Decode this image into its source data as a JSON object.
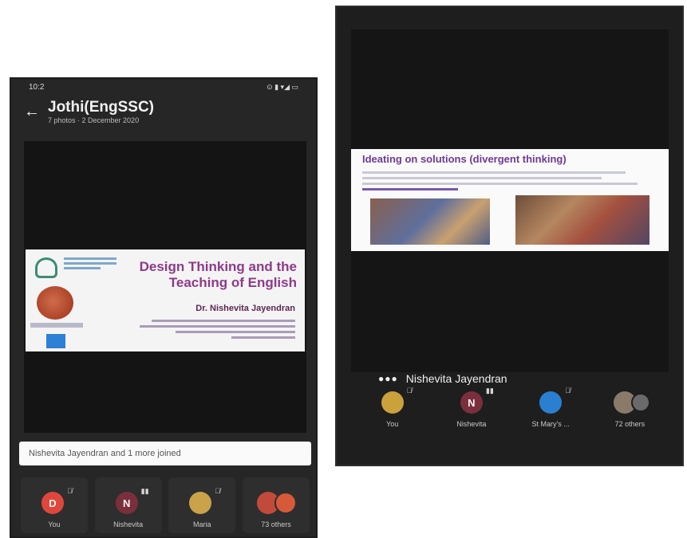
{
  "left_phone": {
    "status": {
      "time": "10:2",
      "icons": "⊙ ▮ ▾◢ ▭"
    },
    "header": {
      "title": "Jothi(EngSSC)",
      "subtitle": "7 photos · 2 December 2020"
    },
    "slide": {
      "title": "Design Thinking and the Teaching of English",
      "author": "Dr. Nishevita Jayendran"
    },
    "toast": "Nishevita Jayendran and 1 more joined",
    "participants": [
      {
        "initial": "D",
        "label": "You",
        "color": "#e0473c",
        "mic": "🎙̸"
      },
      {
        "initial": "N",
        "label": "Nishevita",
        "color": "#7b2f3d",
        "mic": "▮▮"
      },
      {
        "initial": "",
        "label": "Maria",
        "color": "#c9a24a",
        "mic": "🎙̸"
      },
      {
        "initial": "",
        "label": "73 others",
        "color": "#c24a3a",
        "mic": ""
      }
    ]
  },
  "right_phone": {
    "slide": {
      "title": "Ideating on solutions (divergent thinking)"
    },
    "speaker": "Nishevita Jayendran",
    "participants": [
      {
        "initial": "",
        "label": "You",
        "color": "#caa13b",
        "mic": "🎙̸"
      },
      {
        "initial": "N",
        "label": "Nishevita",
        "color": "#7b2f3d",
        "mic": "▮▮"
      },
      {
        "initial": "",
        "label": "St Mary's ...",
        "color": "#2a7fd0",
        "mic": "🎙̸"
      },
      {
        "initial": "",
        "label": "72 others",
        "color": "#8a7a6a",
        "mic": ""
      }
    ]
  }
}
